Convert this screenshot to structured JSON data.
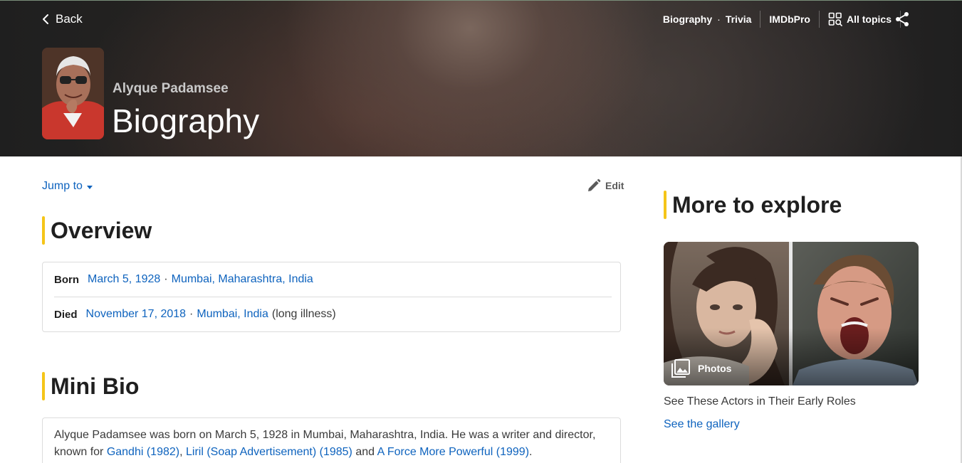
{
  "header": {
    "back_label": "Back",
    "nav": {
      "biography": "Biography",
      "dot": "·",
      "trivia": "Trivia",
      "imdbpro": "IMDbPro",
      "all_topics": "All topics"
    },
    "person_name": "Alyque Padamsee",
    "page_title": "Biography"
  },
  "toolbar": {
    "jump_to": "Jump to",
    "edit": "Edit"
  },
  "overview": {
    "title": "Overview",
    "born": {
      "label": "Born",
      "date": "March 5, 1928",
      "sep": "·",
      "place": "Mumbai, Maharashtra, India"
    },
    "died": {
      "label": "Died",
      "date": "November 17, 2018",
      "sep": "·",
      "place": "Mumbai, India",
      "note": "(long illness)"
    }
  },
  "mini_bio": {
    "title": "Mini Bio",
    "text_1": "Alyque Padamsee was born on March 5, 1928 in Mumbai, Maharashtra, India. He was a writer and director, known for ",
    "link_1": "Gandhi (1982)",
    "text_2": ", ",
    "link_2": "Liril (Soap Advertisement) (1985)",
    "text_3": " and ",
    "link_3": "A Force More Powerful (1999)",
    "text_4": "."
  },
  "sidebar": {
    "title": "More to explore",
    "badge": "Photos",
    "caption": "See These Actors in Their Early Roles",
    "link": "See the gallery"
  },
  "colors": {
    "accent": "#f5c518",
    "link": "#0e63be",
    "hero_bg": "#1f1f1f"
  }
}
